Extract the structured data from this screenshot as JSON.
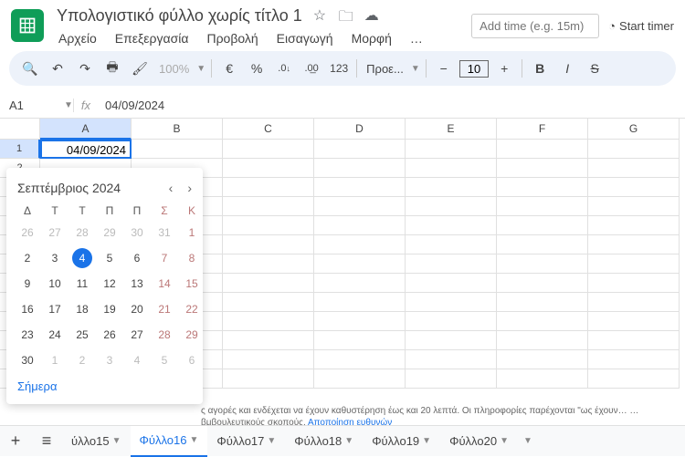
{
  "header": {
    "title": "Υπολογιστικό φύλλο χωρίς τίτλο 1",
    "time_placeholder": "Add time (e.g. 15m)",
    "start_timer": "Start timer"
  },
  "menu": [
    "Αρχείο",
    "Επεξεργασία",
    "Προβολή",
    "Εισαγωγή",
    "Μορφή",
    "…"
  ],
  "toolbar": {
    "zoom": "100%",
    "currency": "€",
    "pct": "%",
    "dec_dec": ".0",
    "dec_inc": ".00",
    "num": "123",
    "font": "Προε...",
    "size": "10",
    "bold": "B",
    "italic": "I",
    "strike": "S"
  },
  "cellref": {
    "ref": "A1",
    "fx": "fx",
    "val": "04/09/2024"
  },
  "cols": [
    "A",
    "B",
    "C",
    "D",
    "E",
    "F",
    "G"
  ],
  "active_cell_value": "04/09/2024",
  "dp": {
    "month": "Σεπτέμβριος 2024",
    "dow": [
      "Δ",
      "Τ",
      "Τ",
      "Π",
      "Π",
      "Σ",
      "Κ"
    ],
    "rows": [
      [
        {
          "d": "26",
          "o": 1
        },
        {
          "d": "27",
          "o": 1
        },
        {
          "d": "28",
          "o": 1
        },
        {
          "d": "29",
          "o": 1
        },
        {
          "d": "30",
          "o": 1
        },
        {
          "d": "31",
          "o": 1,
          "w": 1
        },
        {
          "d": "1",
          "w": 1
        }
      ],
      [
        {
          "d": "2"
        },
        {
          "d": "3"
        },
        {
          "d": "4",
          "t": 1
        },
        {
          "d": "5"
        },
        {
          "d": "6"
        },
        {
          "d": "7",
          "w": 1
        },
        {
          "d": "8",
          "w": 1
        }
      ],
      [
        {
          "d": "9"
        },
        {
          "d": "10"
        },
        {
          "d": "11"
        },
        {
          "d": "12"
        },
        {
          "d": "13"
        },
        {
          "d": "14",
          "w": 1
        },
        {
          "d": "15",
          "w": 1
        }
      ],
      [
        {
          "d": "16"
        },
        {
          "d": "17"
        },
        {
          "d": "18"
        },
        {
          "d": "19"
        },
        {
          "d": "20"
        },
        {
          "d": "21",
          "w": 1
        },
        {
          "d": "22",
          "w": 1
        }
      ],
      [
        {
          "d": "23"
        },
        {
          "d": "24"
        },
        {
          "d": "25"
        },
        {
          "d": "26"
        },
        {
          "d": "27"
        },
        {
          "d": "28",
          "w": 1
        },
        {
          "d": "29",
          "w": 1
        }
      ],
      [
        {
          "d": "30"
        },
        {
          "d": "1",
          "o": 1
        },
        {
          "d": "2",
          "o": 1
        },
        {
          "d": "3",
          "o": 1
        },
        {
          "d": "4",
          "o": 1
        },
        {
          "d": "5",
          "o": 1,
          "w": 1
        },
        {
          "d": "6",
          "o": 1,
          "w": 1
        }
      ]
    ],
    "today": "Σήμερα"
  },
  "disclaimer": {
    "text": "ς αγορές και ενδέχεται να έχουν καθυστέρηση έως και 20 λεπτά. Οι πληροφορίες παρέχονται \"ως έχουν… …βμβουλευτικούς σκοπούς.",
    "link": "Αποποίηση ευθυνών"
  },
  "tabs": {
    "items": [
      "ύλλο15",
      "Φύλλο16",
      "Φύλλο17",
      "Φύλλο18",
      "Φύλλο19",
      "Φύλλο20"
    ],
    "active": 1
  }
}
